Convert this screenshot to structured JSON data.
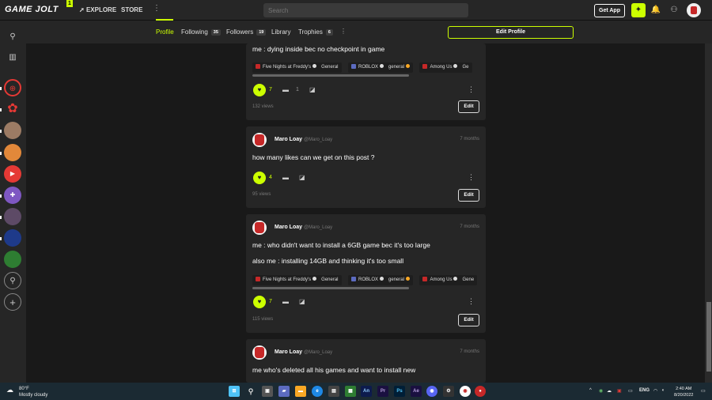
{
  "topbar": {
    "logo": "GAME JOLT",
    "logo_badge": "1",
    "explore": "EXPLORE",
    "store": "STORE",
    "search_placeholder": "Search",
    "get_app": "Get App"
  },
  "profile_nav": {
    "tabs": [
      {
        "label": "Profile"
      },
      {
        "label": "Following",
        "count": "35"
      },
      {
        "label": "Followers",
        "count": "19"
      },
      {
        "label": "Library"
      },
      {
        "label": "Trophies",
        "count": "6"
      }
    ],
    "edit_profile": "Edit Profile"
  },
  "posts": [
    {
      "lines": [
        "me : dying inside bec no checkpoint in game"
      ],
      "tags": [
        {
          "name": "Five Nights at Freddy's",
          "channel": "General"
        },
        {
          "name": "ROBLOX",
          "channel": "general"
        },
        {
          "name": "Among Us",
          "channel": "Ge"
        }
      ],
      "likes": "7",
      "comments": "1",
      "views": "132 views",
      "edit": "Edit"
    },
    {
      "author": "Maro Loay",
      "handle": "@Maro_Loay",
      "age": "7 months",
      "lines": [
        "how many likes can we get on this post ?"
      ],
      "likes": "4",
      "views": "95 views",
      "edit": "Edit"
    },
    {
      "author": "Maro Loay",
      "handle": "@Maro_Loay",
      "age": "7 months",
      "lines": [
        "me : who didn't want to install a 6GB game bec it's too large",
        "also me : installing 14GB and thinking it's too small"
      ],
      "tags": [
        {
          "name": "Five Nights at Freddy's",
          "channel": "General"
        },
        {
          "name": "ROBLOX",
          "channel": "general"
        },
        {
          "name": "Among Us",
          "channel": "Gene"
        }
      ],
      "likes": "7",
      "views": "115 views",
      "edit": "Edit"
    },
    {
      "author": "Maro Loay",
      "handle": "@Maro_Loay",
      "age": "7 months",
      "lines": [
        "me who's deleted all his games and want to install new"
      ]
    }
  ],
  "taskbar": {
    "temperature": "80°F",
    "weather": "Mostly cloudy",
    "language": "ENG",
    "time": "2:40 AM",
    "date": "8/20/2022",
    "apps": [
      "An",
      "Pr",
      "Ps",
      "Ae"
    ]
  },
  "colors": {
    "accent": "#ccff00",
    "background": "#191919",
    "card": "#262626"
  }
}
